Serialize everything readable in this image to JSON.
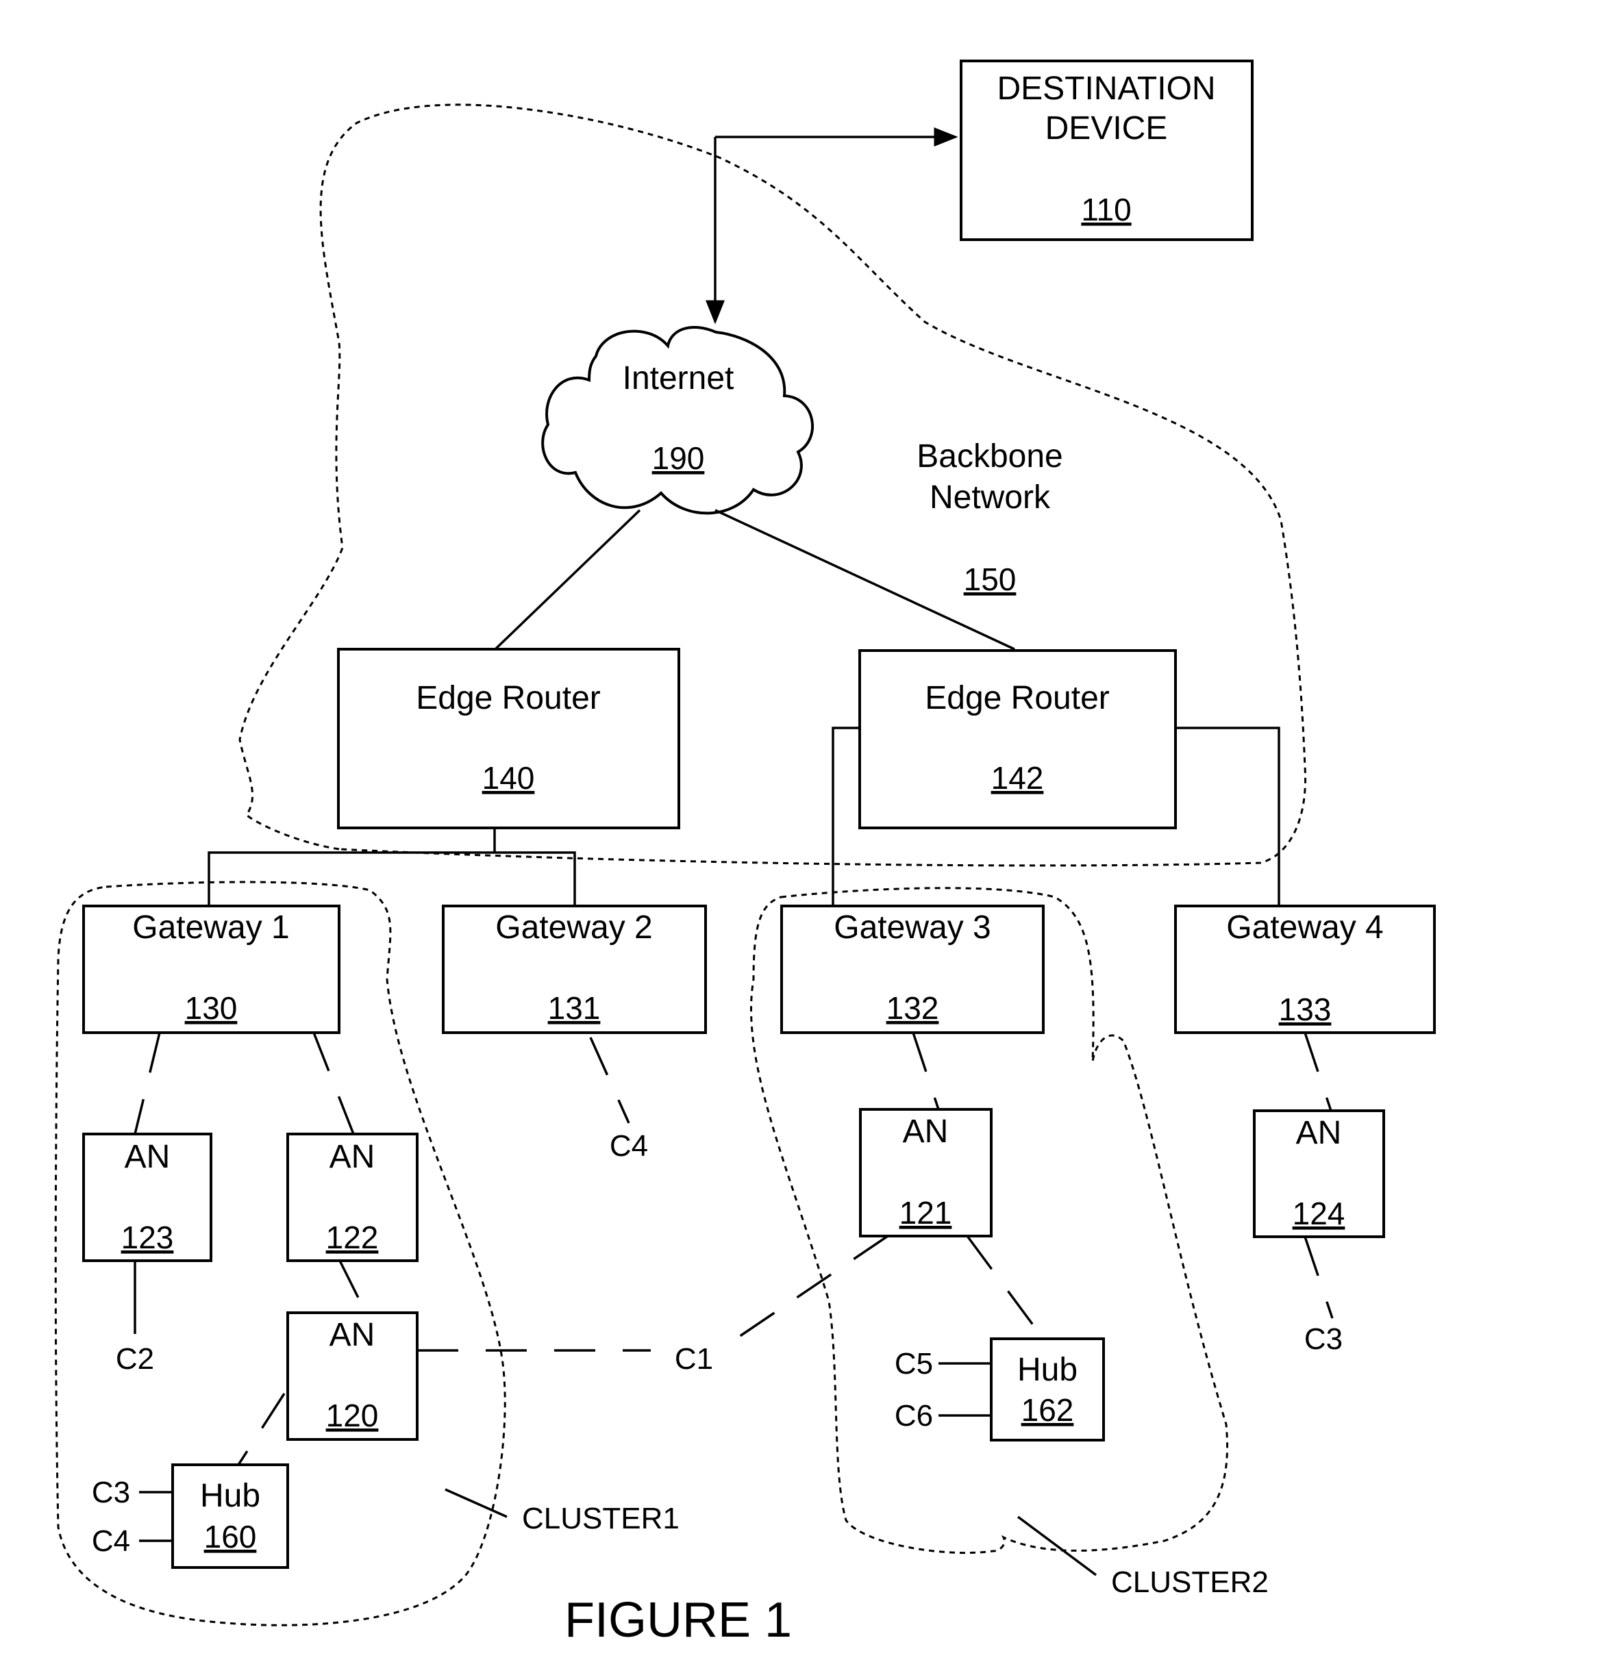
{
  "figure": {
    "caption": "FIGURE 1",
    "nodes": {
      "destination": {
        "line1": "DESTINATION",
        "line2": "DEVICE",
        "ref": "110"
      },
      "internet": {
        "label": "Internet",
        "ref": "190"
      },
      "backbone": {
        "line1": "Backbone",
        "line2": "Network",
        "ref": "150"
      },
      "edge_router_1": {
        "label": "Edge Router",
        "ref": "140"
      },
      "edge_router_2": {
        "label": "Edge Router",
        "ref": "142"
      },
      "gateway_1": {
        "label": "Gateway 1",
        "ref": "130"
      },
      "gateway_2": {
        "label": "Gateway 2",
        "ref": "131"
      },
      "gateway_3": {
        "label": "Gateway 3",
        "ref": "132"
      },
      "gateway_4": {
        "label": "Gateway 4",
        "ref": "133"
      },
      "an_123": {
        "label": "AN",
        "ref": "123"
      },
      "an_122": {
        "label": "AN",
        "ref": "122"
      },
      "an_120": {
        "label": "AN",
        "ref": "120"
      },
      "an_121": {
        "label": "AN",
        "ref": "121"
      },
      "an_124": {
        "label": "AN",
        "ref": "124"
      },
      "hub_160": {
        "label": "Hub",
        "ref": "160"
      },
      "hub_162": {
        "label": "Hub",
        "ref": "162"
      }
    },
    "clients": {
      "c2": "C2",
      "c4_gw2": "C4",
      "c1": "C1",
      "c3_an124": "C3",
      "c3_hub160": "C3",
      "c4_hub160": "C4",
      "c5": "C5",
      "c6": "C6"
    },
    "clusters": {
      "cluster1": "CLUSTER1",
      "cluster2": "CLUSTER2"
    }
  }
}
